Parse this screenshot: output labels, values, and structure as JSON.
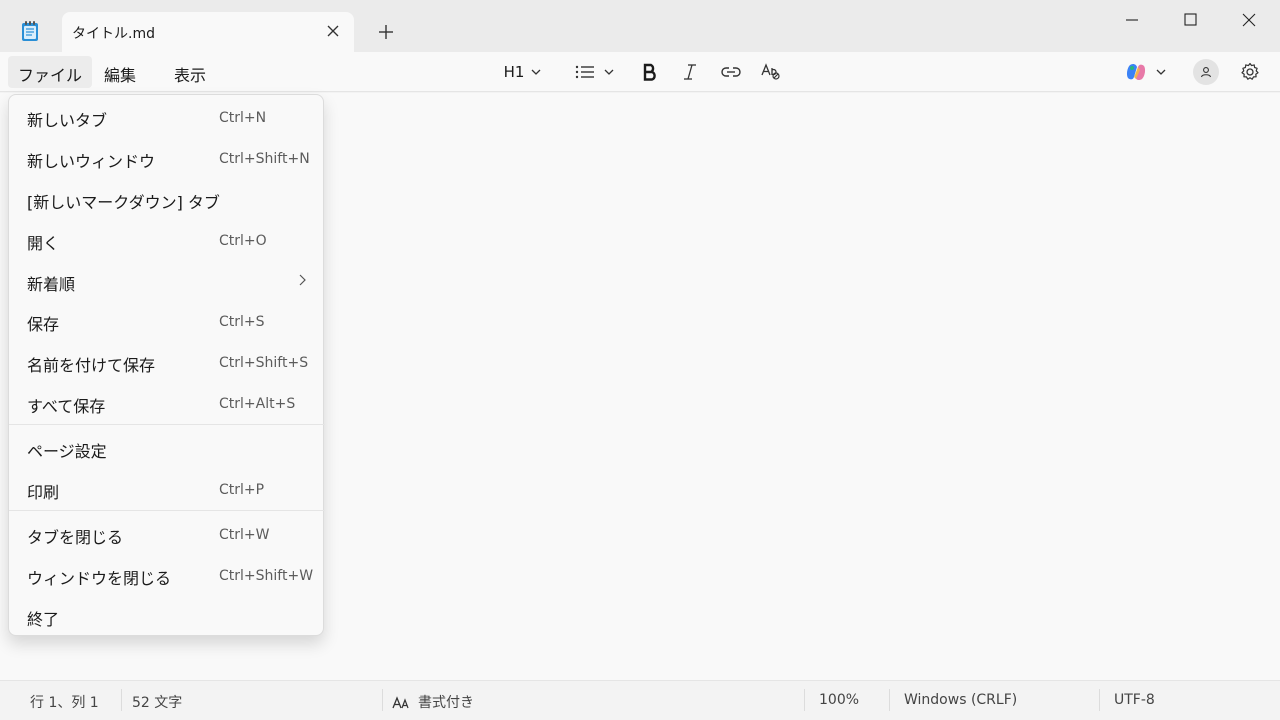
{
  "window": {
    "tab_title": "タイトル.md"
  },
  "menubar": {
    "file": "ファイル",
    "edit": "編集",
    "view": "表示"
  },
  "toolbar": {
    "heading_label": "H1",
    "icons": [
      "list-icon",
      "bold-icon",
      "italic-icon",
      "link-icon",
      "spellcheck-icon",
      "copilot-icon",
      "account-icon",
      "settings-icon"
    ]
  },
  "file_menu": {
    "items": [
      {
        "label": "新しいタブ",
        "shortcut": "Ctrl+N"
      },
      {
        "label": "新しいウィンドウ",
        "shortcut": "Ctrl+Shift+N"
      },
      {
        "label": "[新しいマークダウン] タブ",
        "shortcut": ""
      },
      {
        "label": "開く",
        "shortcut": "Ctrl+O"
      },
      {
        "label": "新着順",
        "shortcut": ""
      },
      {
        "label": "保存",
        "shortcut": "Ctrl+S"
      },
      {
        "label": "名前を付けて保存",
        "shortcut": "Ctrl+Shift+S"
      },
      {
        "label": "すべて保存",
        "shortcut": "Ctrl+Alt+S"
      },
      {
        "label": "ページ設定",
        "shortcut": ""
      },
      {
        "label": "印刷",
        "shortcut": "Ctrl+P"
      },
      {
        "label": "タブを閉じる",
        "shortcut": "Ctrl+W"
      },
      {
        "label": "ウィンドウを閉じる",
        "shortcut": "Ctrl+Shift+W"
      },
      {
        "label": "終了",
        "shortcut": ""
      }
    ]
  },
  "statusbar": {
    "position": "行 1、列 1",
    "char_count": "52 文字",
    "format": "書式付き",
    "zoom": "100%",
    "line_ending": "Windows (CRLF)",
    "encoding": "UTF-8"
  },
  "colors": {
    "titlebar_bg": "#ebebeb",
    "surface": "#f9f9f9",
    "accent_copilot": "#7b5cff"
  }
}
